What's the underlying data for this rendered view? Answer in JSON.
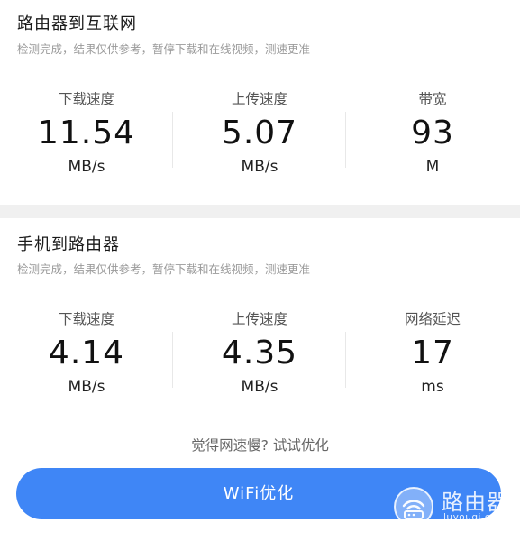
{
  "router_to_internet": {
    "title": "路由器到互联网",
    "subtitle": "检测完成，结果仅供参考，暂停下载和在线视频，测速更准",
    "metrics": [
      {
        "label": "下载速度",
        "value": "11.54",
        "unit": "MB/s"
      },
      {
        "label": "上传速度",
        "value": "5.07",
        "unit": "MB/s"
      },
      {
        "label": "带宽",
        "value": "93",
        "unit": "M"
      }
    ]
  },
  "phone_to_router": {
    "title": "手机到路由器",
    "subtitle": "检测完成，结果仅供参考，暂停下载和在线视频，测速更准",
    "metrics": [
      {
        "label": "下载速度",
        "value": "4.14",
        "unit": "MB/s"
      },
      {
        "label": "上传速度",
        "value": "4.35",
        "unit": "MB/s"
      },
      {
        "label": "网络延迟",
        "value": "17",
        "unit": "ms"
      }
    ]
  },
  "optimize": {
    "hint": "觉得网速慢? 试试优化",
    "button_label": "WiFi优化"
  },
  "watermark": {
    "title": "路由器",
    "url": "luyouqi.com",
    "icon": "router-logo-icon"
  },
  "colors": {
    "accent": "#3f86f6",
    "background": "#f0f0f0",
    "card": "#ffffff"
  }
}
